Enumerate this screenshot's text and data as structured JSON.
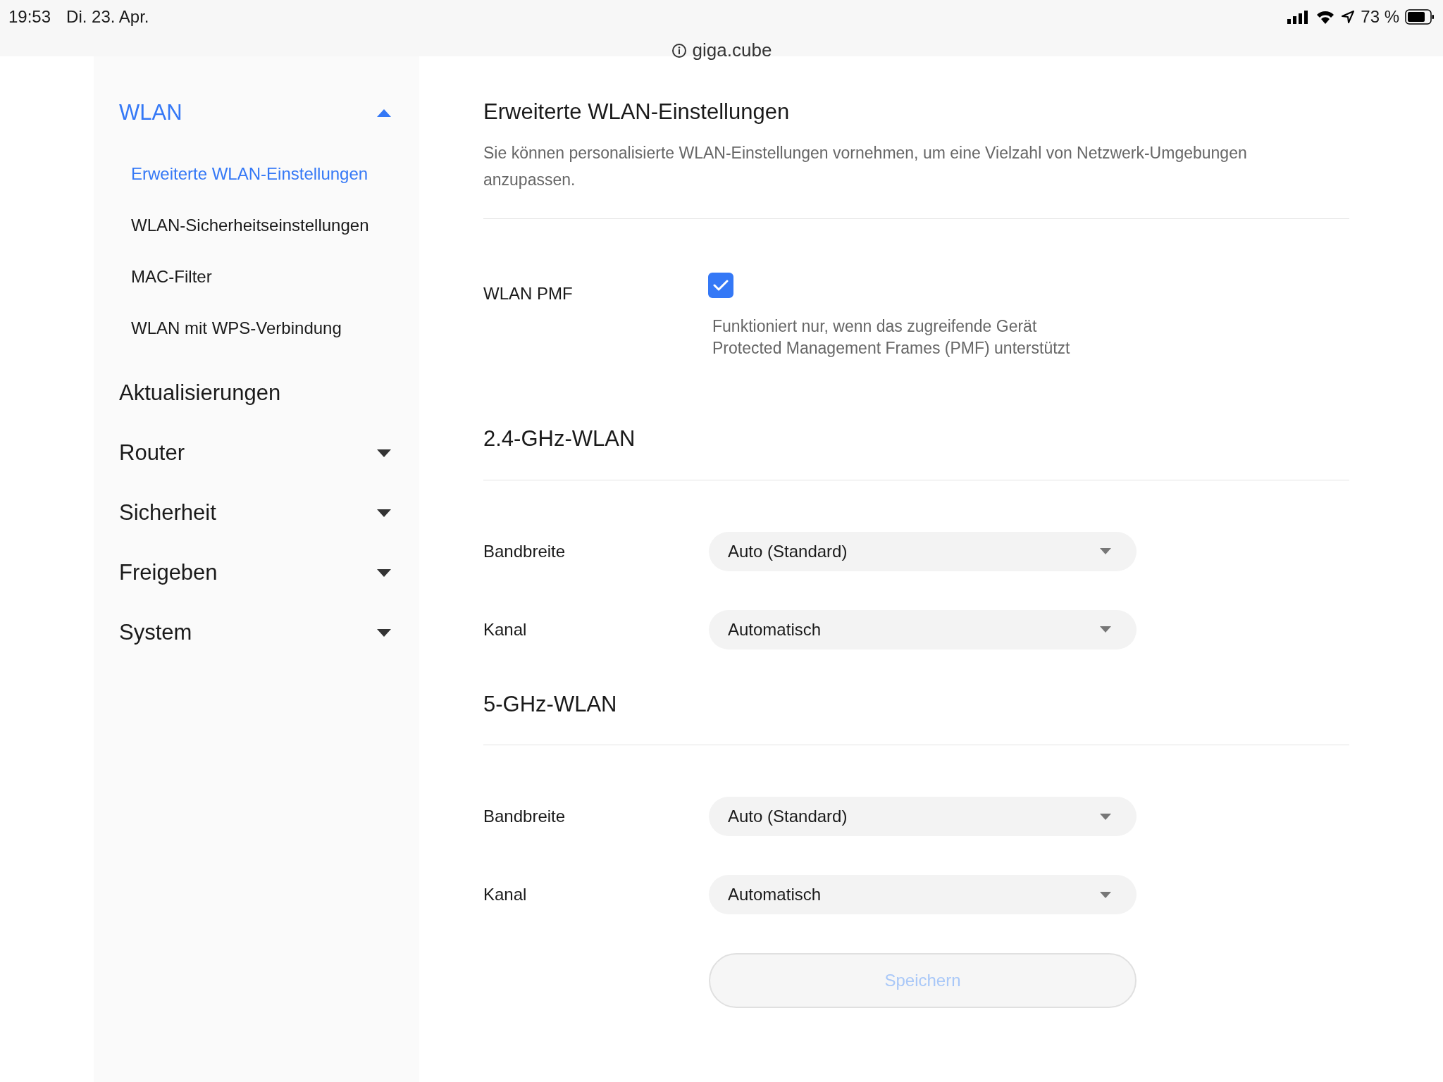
{
  "status_bar": {
    "time": "19:53",
    "date": "Di. 23. Apr.",
    "battery": "73 %"
  },
  "address_bar": {
    "url": "giga.cube"
  },
  "sidebar": {
    "items": [
      {
        "label": "WLAN",
        "selected": true,
        "expanded": true,
        "children": [
          {
            "label": "Erweiterte WLAN-Einstellungen",
            "selected": true
          },
          {
            "label": "WLAN-Sicherheitseinstellungen",
            "selected": false
          },
          {
            "label": "MAC-Filter",
            "selected": false
          },
          {
            "label": "WLAN mit WPS-Verbindung",
            "selected": false
          }
        ]
      },
      {
        "label": "Aktualisierungen",
        "selected": false
      },
      {
        "label": "Router",
        "selected": false,
        "expanded": false
      },
      {
        "label": "Sicherheit",
        "selected": false,
        "expanded": false
      },
      {
        "label": "Freigeben",
        "selected": false,
        "expanded": false
      },
      {
        "label": "System",
        "selected": false,
        "expanded": false
      }
    ]
  },
  "page": {
    "title": "Erweiterte WLAN-Einstellungen",
    "description": "Sie können personalisierte WLAN-Einstellungen vornehmen, um eine Vielzahl von Netzwerk-Umgebungen anzupassen.",
    "pmf": {
      "label": "WLAN PMF",
      "checked": true,
      "hint": "Funktioniert nur, wenn das zugreifende Gerät\nProtected Management Frames (PMF) unterstützt"
    },
    "sections": [
      {
        "title": "2.4-GHz-WLAN",
        "fields": [
          {
            "label": "Bandbreite",
            "value": "Auto (Standard)"
          },
          {
            "label": "Kanal",
            "value": "Automatisch"
          }
        ]
      },
      {
        "title": "5-GHz-WLAN",
        "fields": [
          {
            "label": "Bandbreite",
            "value": "Auto (Standard)"
          },
          {
            "label": "Kanal",
            "value": "Automatisch"
          }
        ]
      }
    ],
    "save_button": {
      "label": "Speichern",
      "disabled": true
    }
  }
}
